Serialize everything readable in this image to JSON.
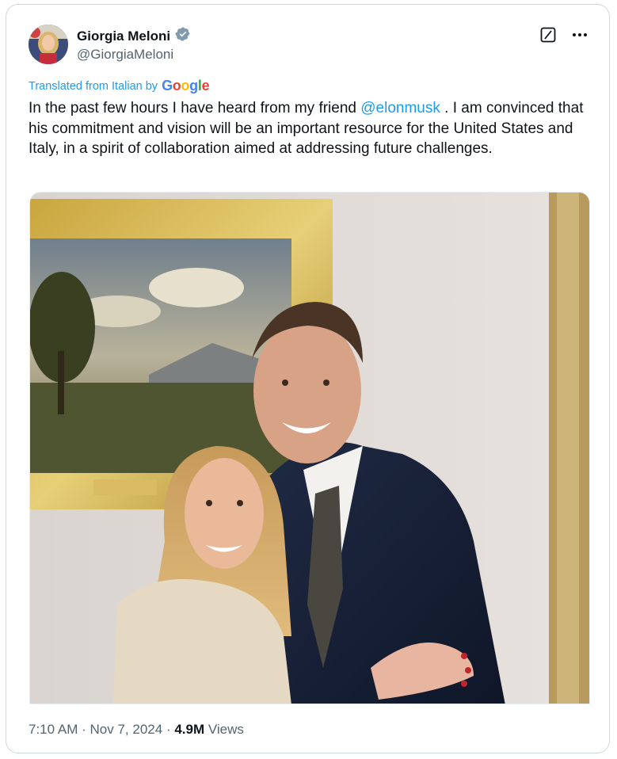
{
  "author": {
    "display_name": "Giorgia Meloni",
    "handle": "@GiorgiaMeloni",
    "verified": true
  },
  "translation": {
    "label": "Translated from Italian by",
    "provider": "Google"
  },
  "tweet": {
    "text_before": "In the past few hours I have heard from my friend ",
    "mention": "@elonmusk",
    "text_after": " . I am convinced that his commitment and vision will be an important resource for the United States and Italy, in a spirit of collaboration aimed at addressing future challenges."
  },
  "meta": {
    "time": "7:10 AM",
    "date": "Nov 7, 2024",
    "views_count": "4.9M",
    "views_label": "Views",
    "separator": "·"
  },
  "icons": [
    "verified-badge-icon",
    "grok-icon",
    "more-options-icon"
  ]
}
